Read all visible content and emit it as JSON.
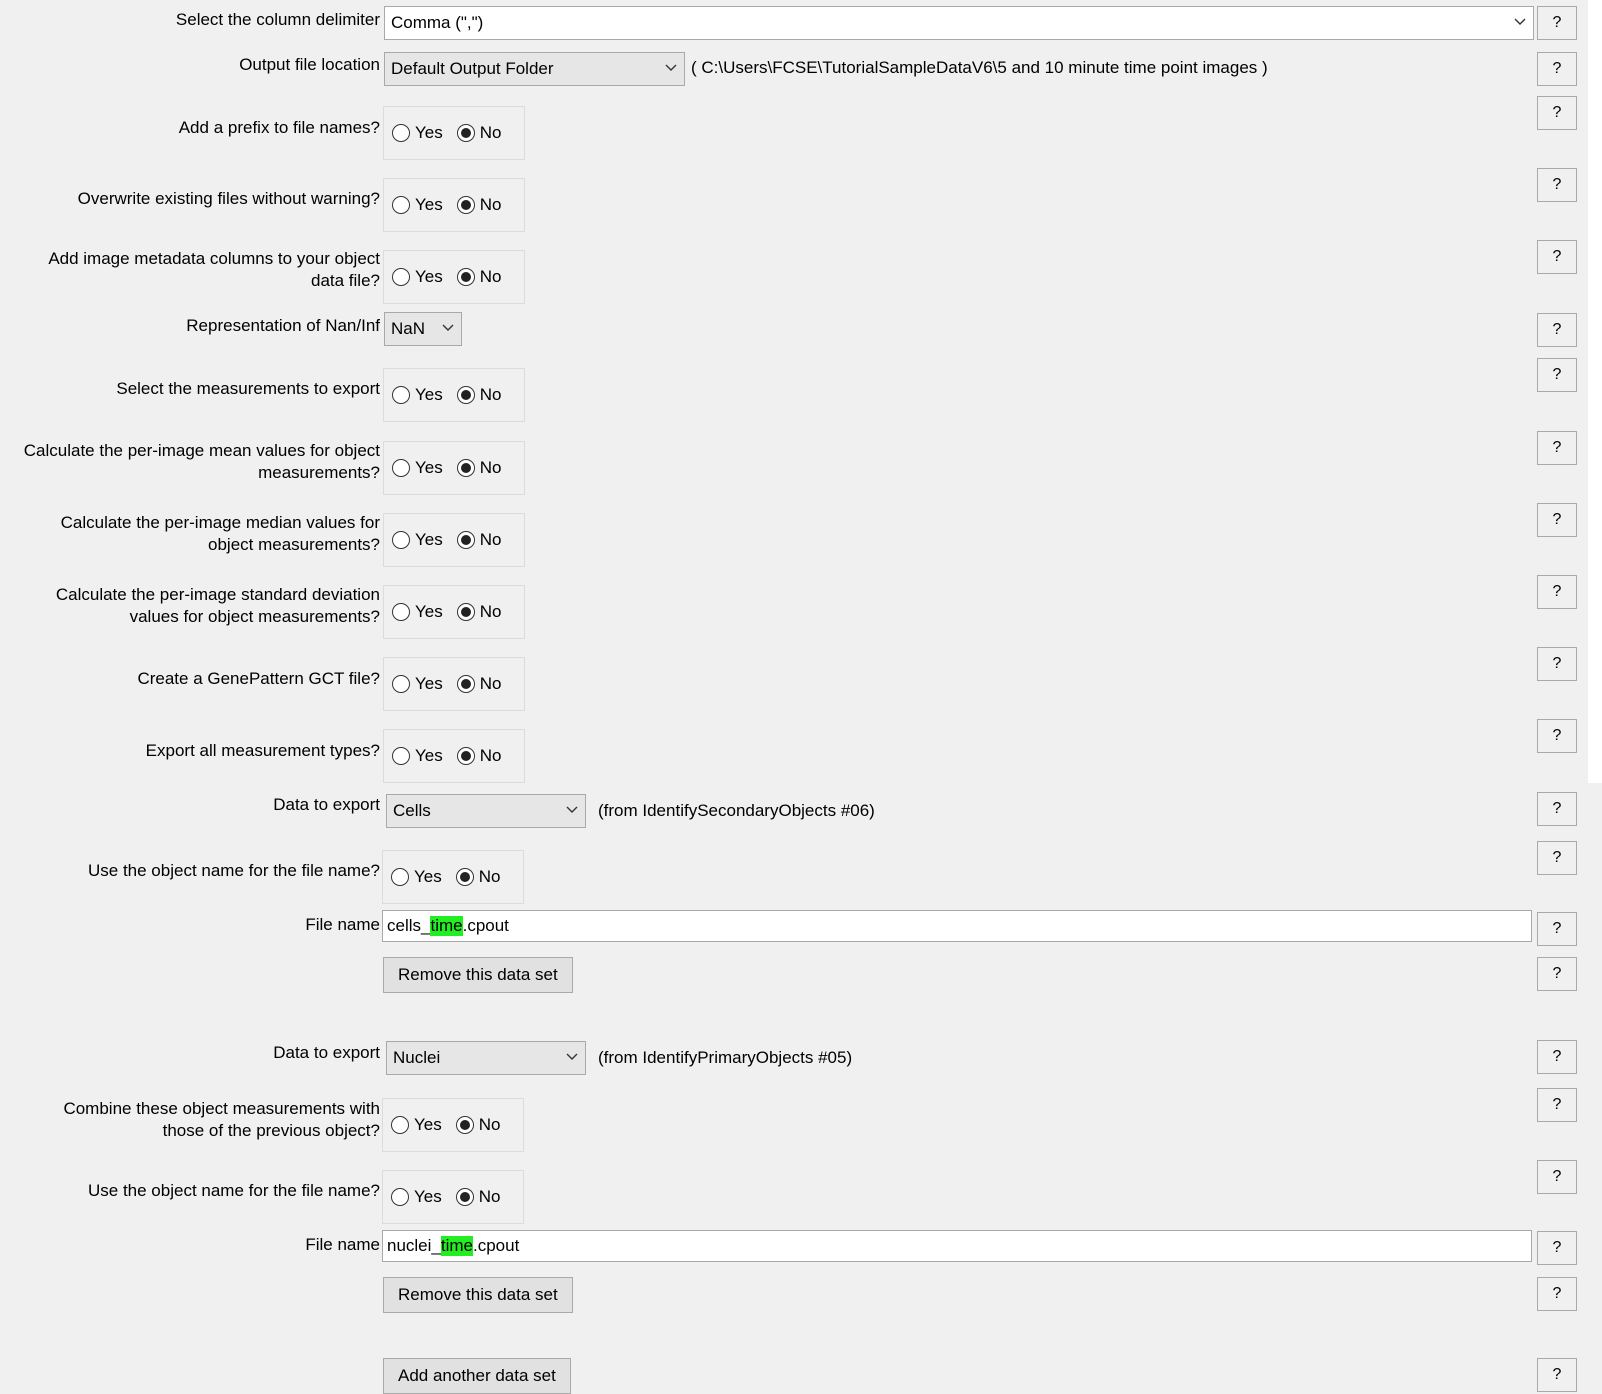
{
  "help_label": "?",
  "delimiter": {
    "label": "Select the column delimiter",
    "value": "Comma (\",\")"
  },
  "output_location": {
    "label": "Output file location",
    "value": "Default Output Folder",
    "path": "( C:\\Users\\FCSE\\TutorialSampleDataV6\\5 and 10 minute time point images )"
  },
  "radio_options": {
    "yes": "Yes",
    "no": "No"
  },
  "settings": [
    {
      "label": "Add a prefix to file names?",
      "selected": "No"
    },
    {
      "label": "Overwrite existing files without warning?",
      "selected": "No"
    },
    {
      "label_line1": "Add image metadata columns to your object",
      "label_line2": "data file?",
      "selected": "No"
    },
    {
      "label": "Select the measurements to export",
      "selected": "No"
    },
    {
      "label_line1": "Calculate the per-image mean values for object",
      "label_line2": "measurements?",
      "selected": "No"
    },
    {
      "label_line1": "Calculate the per-image median values for",
      "label_line2": "object measurements?",
      "selected": "No"
    },
    {
      "label_line1": "Calculate the per-image standard deviation",
      "label_line2": "values for object measurements?",
      "selected": "No"
    },
    {
      "label": "Create a GenePattern GCT file?",
      "selected": "No"
    },
    {
      "label": "Export all measurement types?",
      "selected": "No"
    }
  ],
  "nan": {
    "label": "Representation of Nan/Inf",
    "value": "NaN"
  },
  "dataset1": {
    "data_label": "Data to export",
    "data_value": "Cells",
    "source": "(from IdentifySecondaryObjects #06)",
    "use_name_label": "Use the object name for the file name?",
    "use_name_selected": "No",
    "filename_label": "File name",
    "filename_prefix": "cells_",
    "filename_tag": "time",
    "filename_suffix": ".cpout",
    "remove_label": "Remove this data set"
  },
  "dataset2": {
    "data_label": "Data to export",
    "data_value": "Nuclei",
    "source": "(from IdentifyPrimaryObjects #05)",
    "combine_label_line1": "Combine these object measurements with",
    "combine_label_line2": "those of the previous object?",
    "combine_selected": "No",
    "use_name_label": "Use the object name for the file name?",
    "use_name_selected": "No",
    "filename_label": "File name",
    "filename_prefix": "nuclei_",
    "filename_tag": "time",
    "filename_suffix": ".cpout",
    "remove_label": "Remove this data set"
  },
  "add_label": "Add another data set",
  "colors": {
    "background": "#f0f0f0",
    "highlight": "#22ee22"
  }
}
